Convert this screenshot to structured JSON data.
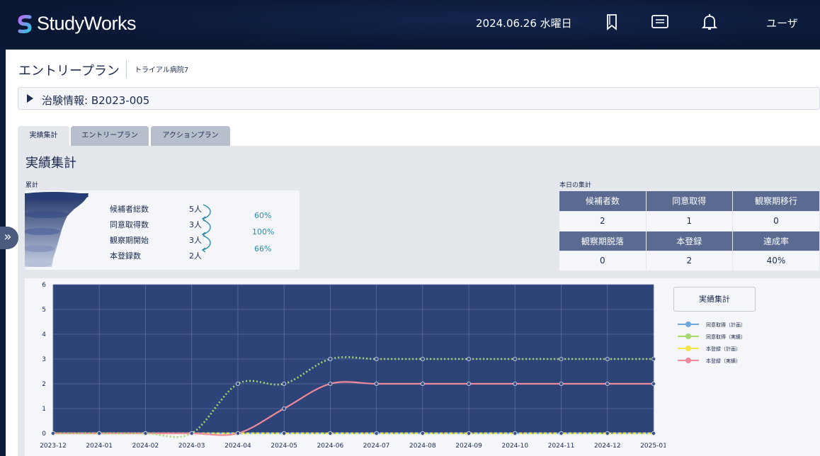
{
  "header": {
    "app_name": "StudyWorks",
    "date": "2024.06.26 水曜日",
    "user": "ユーザ",
    "icons": [
      "bookmark-icon",
      "message-icon",
      "bell-icon"
    ]
  },
  "page": {
    "title": "エントリープラン",
    "hospital": "トライアル病院7",
    "trial_info": "治験情報: B2023-005"
  },
  "tabs": [
    {
      "label": "実績集計",
      "active": true
    },
    {
      "label": "エントリープラン",
      "active": false
    },
    {
      "label": "アクションプラン",
      "active": false
    }
  ],
  "summary": {
    "title": "実績集計",
    "cumulative_label": "累計",
    "rows": [
      {
        "label": "候補者総数",
        "value": "5人"
      },
      {
        "label": "同意取得数",
        "value": "3人"
      },
      {
        "label": "観察期開始",
        "value": "3人"
      },
      {
        "label": "本登録数",
        "value": "2人"
      }
    ],
    "rates": [
      "60%",
      "100%",
      "66%"
    ]
  },
  "today": {
    "label": "本日の集計",
    "headers1": [
      "候補者数",
      "同意取得",
      "観察期移行"
    ],
    "values1": [
      "2",
      "1",
      "0"
    ],
    "headers2": [
      "観察期脱落",
      "本登録",
      "達成率"
    ],
    "values2": [
      "0",
      "2",
      "40%"
    ]
  },
  "chart_button": "実績集計",
  "colors": {
    "plot_bg": "#2e4377",
    "consent_plan": "#6fa8dc",
    "consent_actual": "#a8d86e",
    "register_plan": "#f4e44a",
    "register_actual": "#f08a9a",
    "table_header": "#5a6a90"
  },
  "chart_data": {
    "type": "line",
    "x": [
      "2023-12",
      "2024-01",
      "2024-02",
      "2024-03",
      "2024-04",
      "2024-05",
      "2024-06",
      "2024-07",
      "2024-08",
      "2024-09",
      "2024-10",
      "2024-11",
      "2024-12",
      "2025-01"
    ],
    "ylim": [
      0,
      6
    ],
    "yticks": [
      0,
      1,
      2,
      3,
      4,
      5,
      6
    ],
    "grid": true,
    "legend_position": "right",
    "series": [
      {
        "name": "同意取得（計画）",
        "color": "#6fa8dc",
        "style": "solid",
        "values": [
          0,
          0,
          0,
          0,
          0,
          0,
          0,
          0,
          0,
          0,
          0,
          0,
          0,
          0
        ]
      },
      {
        "name": "同意取得（実績）",
        "color": "#a8d86e",
        "style": "dotted",
        "values": [
          0,
          0,
          0,
          0,
          2,
          2,
          3,
          3,
          3,
          3,
          3,
          3,
          3,
          3
        ]
      },
      {
        "name": "本登録（計画）",
        "color": "#f4e44a",
        "style": "dashed",
        "values": [
          0,
          0,
          0,
          0,
          0,
          0,
          0,
          0,
          0,
          0,
          0,
          0,
          0,
          0
        ]
      },
      {
        "name": "本登録（実績）",
        "color": "#f08a9a",
        "style": "solid",
        "values": [
          0,
          0,
          0,
          0,
          0,
          1,
          2,
          2,
          2,
          2,
          2,
          2,
          2,
          2
        ]
      }
    ]
  }
}
